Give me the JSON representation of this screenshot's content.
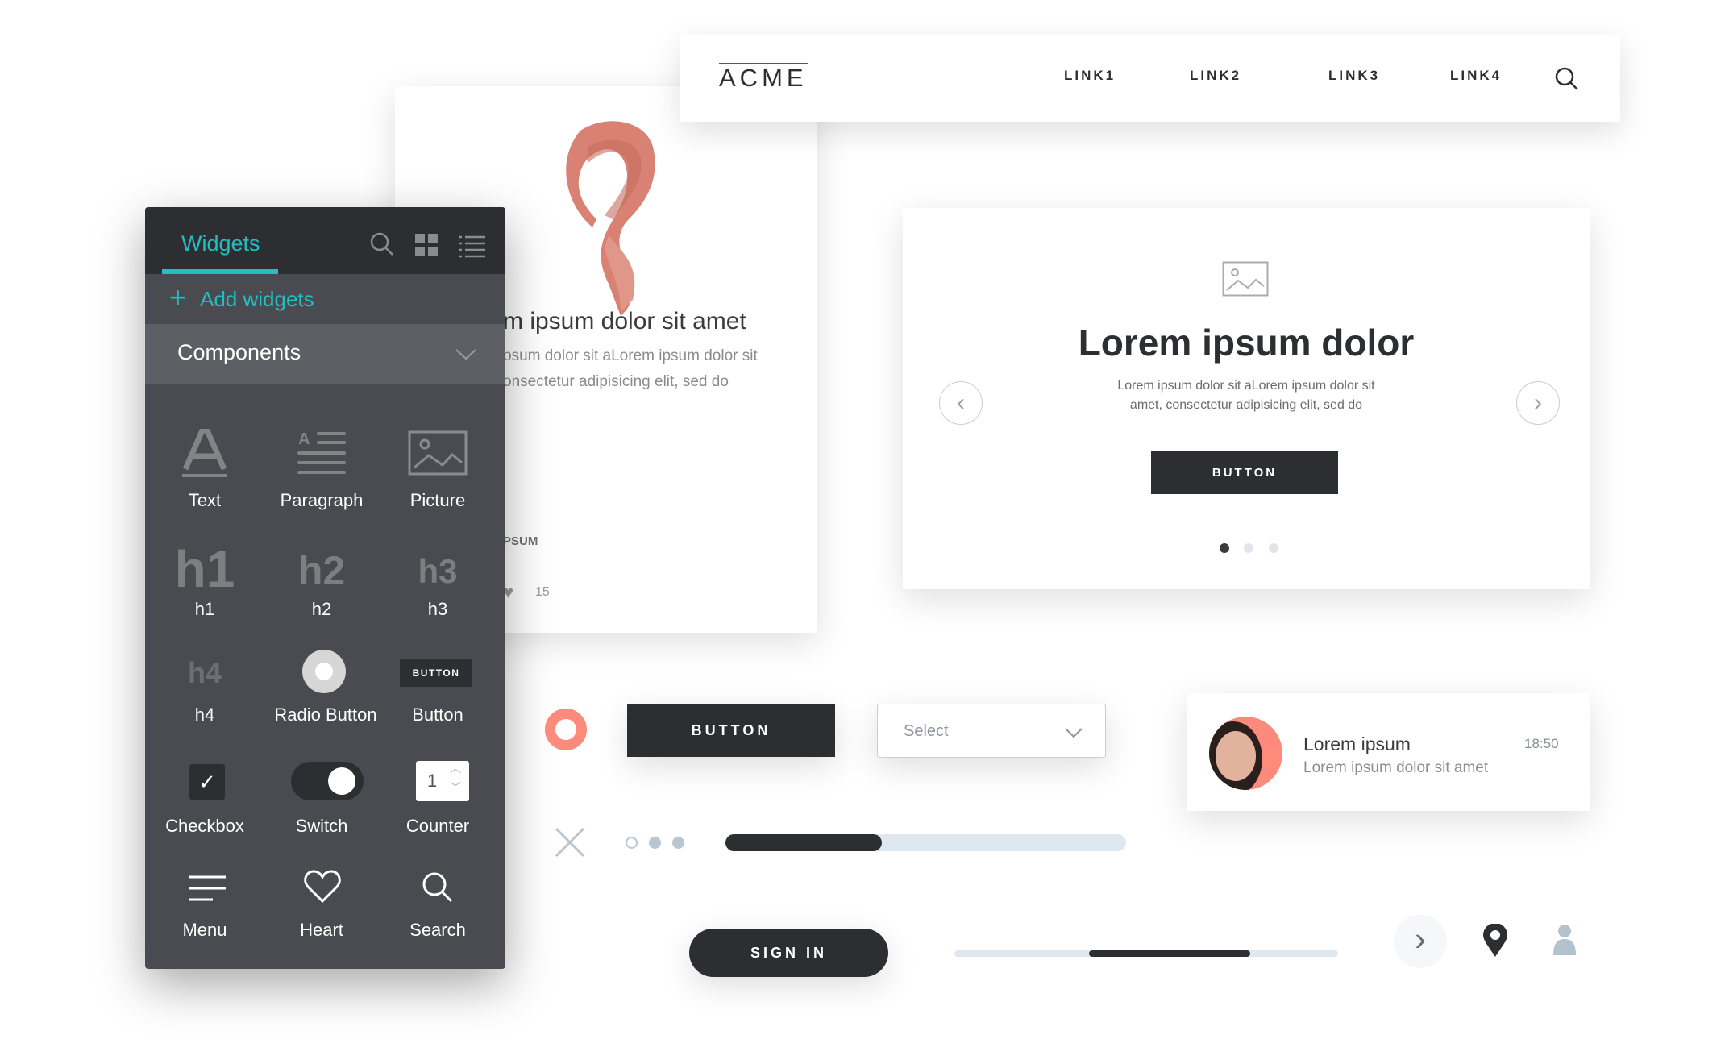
{
  "nav": {
    "logo": "ACME",
    "links": [
      "LINK1",
      "LINK2",
      "LINK3",
      "LINK4"
    ],
    "search_icon": "search-icon"
  },
  "product_card": {
    "title": "m ipsum dolor sit amet",
    "desc_line1": "psum dolor sit aLorem ipsum dolor sit",
    "desc_line2": "onsectetur adipisicing elit, sed do",
    "tag": "PSUM",
    "likes": "15",
    "image": "scarf"
  },
  "widgets_panel": {
    "tab": "Widgets",
    "add_label": "Add widgets",
    "section": "Components",
    "accent": "#22bec0",
    "items": [
      {
        "label": "Text",
        "icon": "text-icon"
      },
      {
        "label": "Paragraph",
        "icon": "paragraph-icon"
      },
      {
        "label": "Picture",
        "icon": "picture-icon"
      },
      {
        "label": "h1",
        "glyph": "h1"
      },
      {
        "label": "h2",
        "glyph": "h2"
      },
      {
        "label": "h3",
        "glyph": "h3"
      },
      {
        "label": "h4",
        "glyph": "h4"
      },
      {
        "label": "Radio Button",
        "icon": "radio-icon"
      },
      {
        "label": "Button",
        "glyph": "BUTTON"
      },
      {
        "label": "Checkbox",
        "icon": "checkbox-icon"
      },
      {
        "label": "Switch",
        "icon": "switch-icon"
      },
      {
        "label": "Counter",
        "glyph": "1"
      },
      {
        "label": "Menu",
        "icon": "menu-icon"
      },
      {
        "label": "Heart",
        "icon": "heart-icon"
      },
      {
        "label": "Search",
        "icon": "search-icon"
      }
    ]
  },
  "carousel": {
    "title": "Lorem ipsum dolor",
    "text_line1": "Lorem ipsum dolor sit aLorem ipsum dolor sit",
    "text_line2": "amet, consectetur adipisicing elit, sed do",
    "button": "BUTTON",
    "active_slide": 1,
    "slides": 3
  },
  "controls": {
    "button": "BUTTON",
    "select_placeholder": "Select",
    "sign_in": "SIGN IN",
    "progress": 0.39,
    "slider_range": [
      0.35,
      0.77
    ],
    "accent": "#fe8a7c",
    "dark": "#2d2e32"
  },
  "chat": {
    "name": "Lorem ipsum",
    "time": "18:50",
    "message": "Lorem ipsum dolor sit amet"
  }
}
